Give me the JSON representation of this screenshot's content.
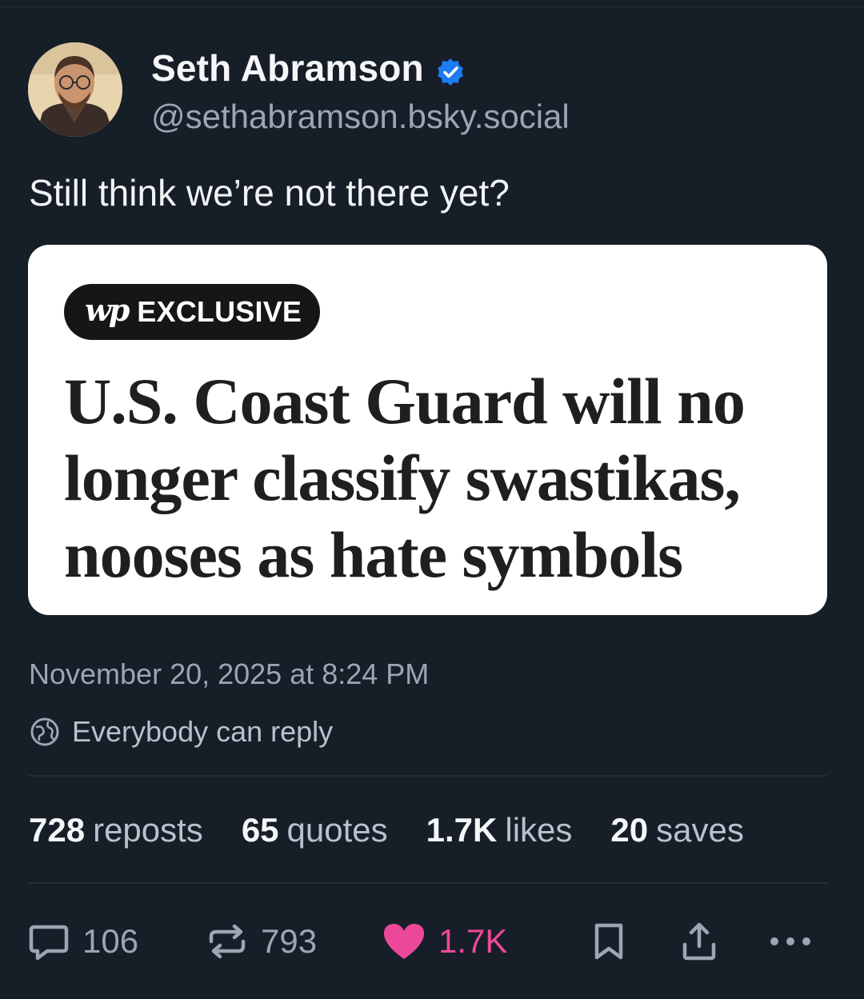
{
  "author": {
    "display_name": "Seth Abramson",
    "handle": "@sethabramson.bsky.social",
    "verified": true
  },
  "post": {
    "text": "Still think we’re not there yet?",
    "timestamp": "November 20, 2025 at 8:24 PM",
    "reply_setting": "Everybody can reply"
  },
  "embed": {
    "logo_text": "wp",
    "tag": "EXCLUSIVE",
    "headline_lines": [
      "U.S. Coast Guard will no",
      "longer classify swastikas,",
      "nooses as hate symbols"
    ]
  },
  "stats": [
    {
      "num": "728",
      "label": "reposts"
    },
    {
      "num": "65",
      "label": "quotes"
    },
    {
      "num": "1.7K",
      "label": "likes"
    },
    {
      "num": "20",
      "label": "saves"
    }
  ],
  "actions": {
    "replies": "106",
    "reposts": "793",
    "likes": "1.7K",
    "liked": true
  },
  "colors": {
    "background": "#161e27",
    "like_pink": "#ec4899",
    "verified_blue": "#1d7cf2"
  }
}
